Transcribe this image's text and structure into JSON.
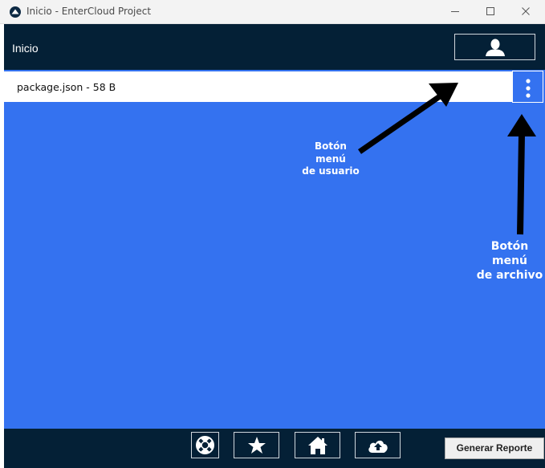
{
  "window": {
    "title": "Inicio - EnterCloud Project",
    "app_icon": "entercloud-logo-icon",
    "controls": [
      "minimize-icon",
      "maximize-icon",
      "close-icon"
    ]
  },
  "header": {
    "title": "Inicio",
    "user_button_icon": "user-icon"
  },
  "file_list": [
    {
      "label": "package.json - 58 B",
      "menu_icon": "vertical-dots-icon"
    }
  ],
  "annotations": {
    "user_menu": [
      "Botón",
      "menú",
      "de usuario"
    ],
    "file_menu": [
      "Botón",
      "menú",
      "de archivo"
    ]
  },
  "footer": {
    "buttons": [
      "lifebuoy-icon",
      "star-icon",
      "home-icon",
      "cloud-upload-icon"
    ],
    "report_label": "Generar Reporte"
  },
  "colors": {
    "header_bg": "#042036",
    "content_bg": "#3472f0",
    "annotation": "#ffffff",
    "arrow": "#000000"
  }
}
